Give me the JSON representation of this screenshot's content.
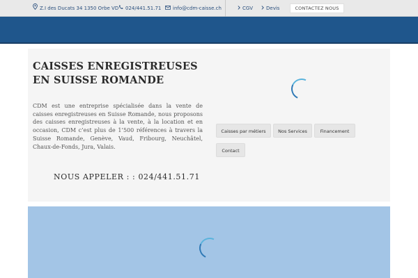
{
  "topbar": {
    "address": "Z.I des Ducats 34 1350 Orbe VD",
    "phone": "024/441.51.71",
    "email": "info@cdm-caisse.ch",
    "links": [
      {
        "label": "CGV"
      },
      {
        "label": "Devis"
      }
    ],
    "cta_label": "CONTACTEZ NOUS"
  },
  "main": {
    "title": "CAISSES ENREGISTREUSES EN SUISSE ROMANDE",
    "description": "CDM est une entreprise spécialisée dans la vente de caisses enregistreuses en Suisse Romande, nous proposons des caisses enregistreuses à la vente, à la location et en occasion, CDM c’est plus de 1’500 références à travers la Suisse Romande, Genève, Vaud, Fribourg, Neuchâtel, Chaux-de-Fonds, Jura, Valais.",
    "call_label": "NOUS APPELER : : 024/441.51.71",
    "buttons": [
      {
        "label": "Caisses par métiers"
      },
      {
        "label": "Nos Services"
      },
      {
        "label": "Financement"
      },
      {
        "label": "Contact"
      }
    ]
  },
  "colors": {
    "header_blue": "#1f568c",
    "light_blue": "#a3c5e6",
    "topbar_bg": "#e9e9e9",
    "link_text": "#2a4f7d"
  },
  "icons": [
    "location-pin-icon",
    "phone-icon",
    "envelope-icon",
    "chevron-right-icon",
    "loading-spinner-icon"
  ]
}
